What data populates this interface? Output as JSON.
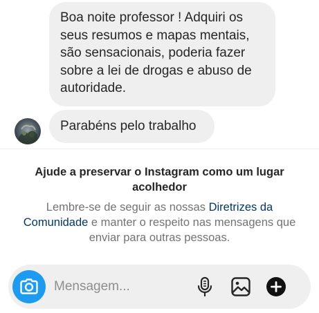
{
  "thread": {
    "messages": [
      {
        "sender": "self",
        "text": "Boa noite professor ! Adquiri os seus resumos e mapas mentais, são sensacionais, poderia fazer sobre a lei de drogas e abuso de autoridade."
      },
      {
        "sender": "self",
        "text": "Parabéns pelo trabalho"
      }
    ]
  },
  "notice": {
    "title": "Ajude a preservar o Instagram como um lugar acolhedor",
    "body_before": "Lembre-se de seguir as nossas ",
    "link_text": "Diretrizes da Comunidade",
    "body_after": " e manter o respeito nas mensagens que enviar para outras pessoas."
  },
  "composer": {
    "placeholder": "Mensagem...",
    "value": "",
    "accent_color": "#1d9bf0",
    "icons": [
      "camera-icon",
      "microphone-icon",
      "gallery-icon",
      "plus-icon"
    ]
  },
  "colors": {
    "bubble_bg": "#efefef",
    "text": "#262626",
    "muted_text": "#737373",
    "link": "#00376b"
  }
}
